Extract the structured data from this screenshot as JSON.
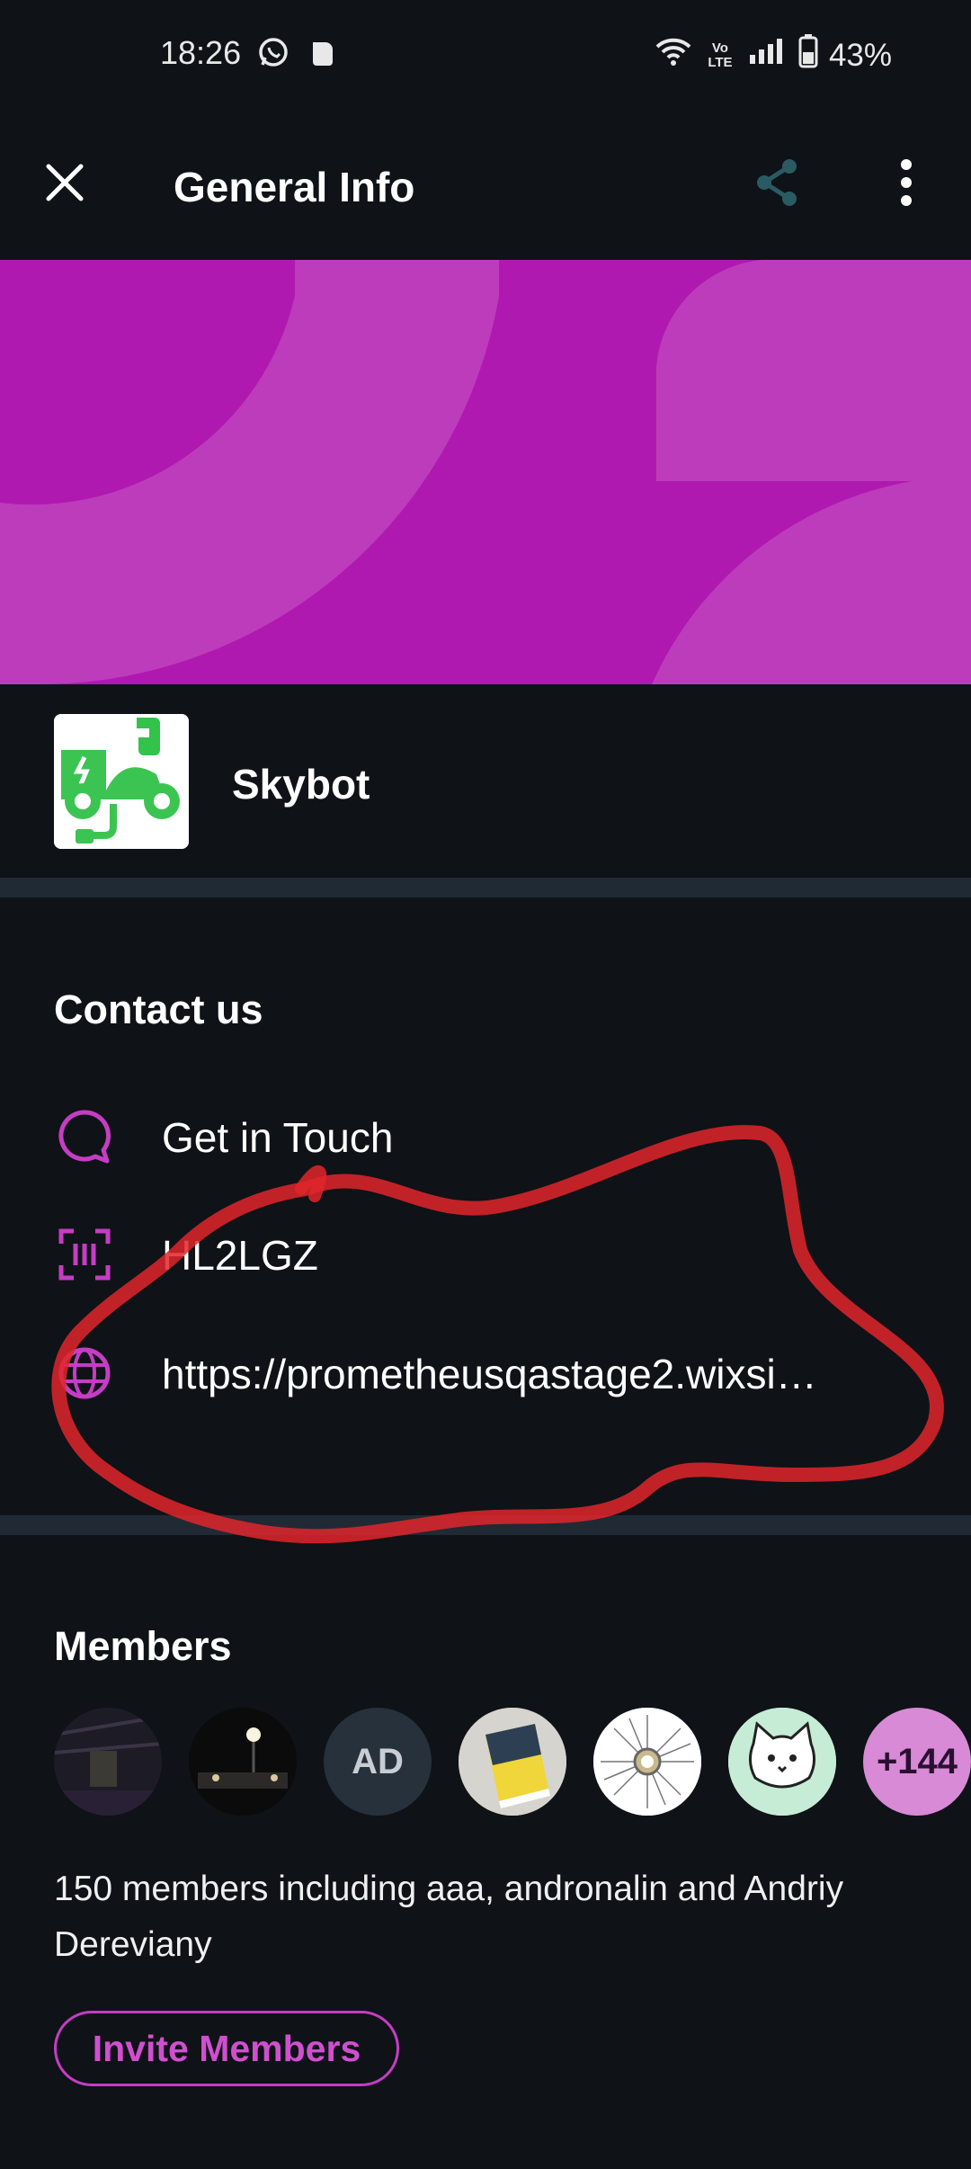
{
  "status_bar": {
    "time": "18:26",
    "battery": "43%",
    "signal_label": "Vo LTE"
  },
  "app_bar": {
    "title": "General Info"
  },
  "group": {
    "name": "Skybot"
  },
  "contact": {
    "section_title": "Contact us",
    "items": [
      {
        "label": "Get in Touch",
        "icon": "chat-bubble-icon"
      },
      {
        "label": "HL2LGZ",
        "icon": "scan-code-icon"
      },
      {
        "label": "https://prometheusqastage2.wixsi…",
        "icon": "globe-icon"
      }
    ]
  },
  "members": {
    "section_title": "Members",
    "avatars": [
      {
        "type": "photo",
        "icon": "member-avatar-photo"
      },
      {
        "type": "photo",
        "icon": "member-avatar-photo"
      },
      {
        "type": "initials",
        "text": "AD"
      },
      {
        "type": "photo",
        "icon": "member-avatar-photo"
      },
      {
        "type": "photo",
        "icon": "member-avatar-photo"
      },
      {
        "type": "photo",
        "icon": "member-avatar-photo"
      },
      {
        "type": "more",
        "text": "+144"
      }
    ],
    "summary": "150 members including aaa, andronalin and Andriy Dereviany",
    "invite_label": "Invite Members"
  },
  "colors": {
    "background": "#0f1217",
    "accent": "#b019af",
    "divider": "#1f2a35",
    "annotation": "#e0262a"
  }
}
